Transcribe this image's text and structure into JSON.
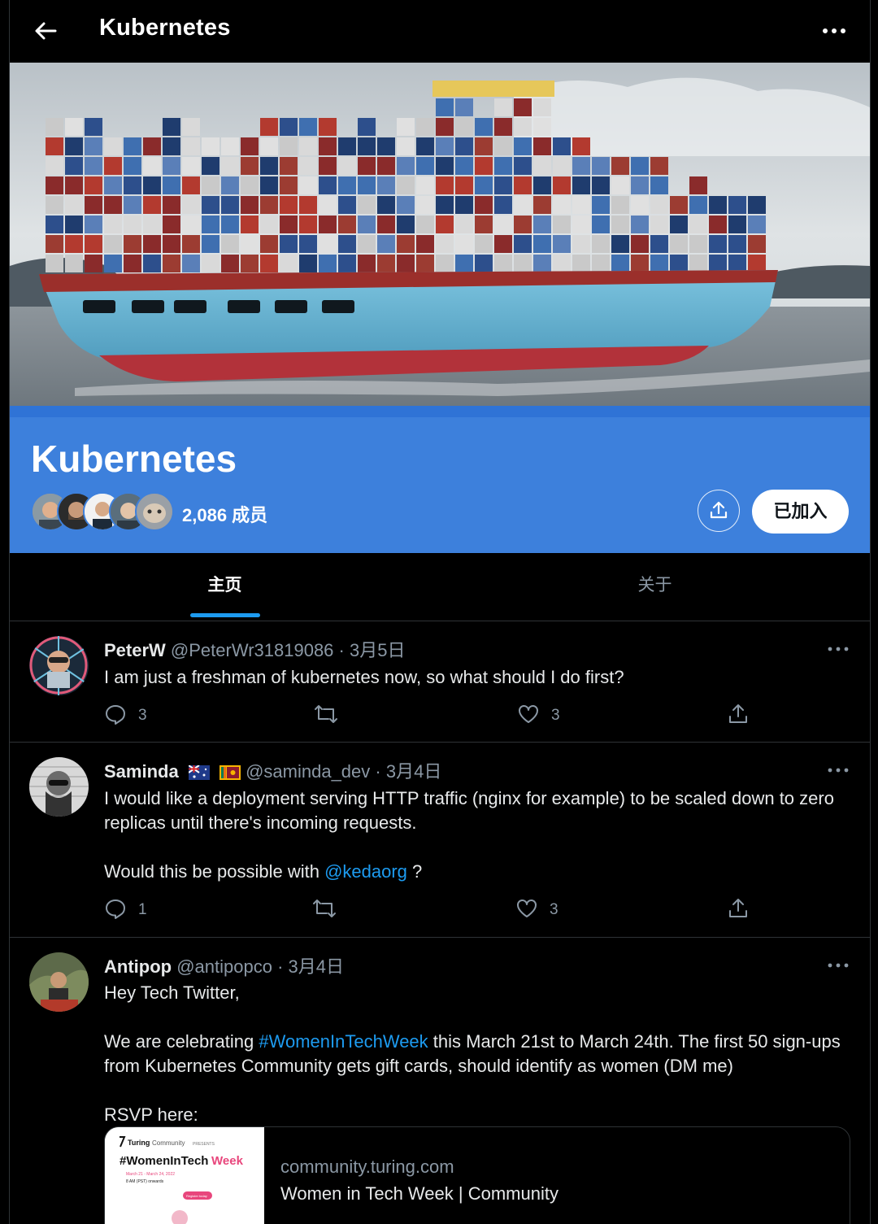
{
  "header": {
    "title": "Kubernetes"
  },
  "community": {
    "name": "Kubernetes",
    "member_count": "2,086 成员",
    "joined_label": "已加入",
    "band_color": "#3d80dc"
  },
  "tabs": [
    {
      "label": "主页",
      "active": true
    },
    {
      "label": "关于",
      "active": false
    }
  ],
  "posts": [
    {
      "name": "PeterW",
      "handle": "@PeterWr31819086",
      "date": "3月5日",
      "text": "I am just a freshman of kubernetes now, so what should I do first?",
      "replies": "3",
      "likes": "3"
    },
    {
      "name": "Saminda",
      "handle": "@saminda_dev",
      "date": "3月4日",
      "text1": "I would like a deployment serving HTTP traffic (nginx for example) to be scaled down to zero replicas until there's  incoming requests.",
      "text2_prefix": "Would this be possible with ",
      "mention": "@kedaorg",
      "text2_suffix": " ?",
      "replies": "1",
      "likes": "3"
    },
    {
      "name": "Antipop",
      "handle": "@antipopco",
      "date": "3月4日",
      "line1": "Hey Tech Twitter,",
      "line2_prefix": "We are celebrating ",
      "hashtag": "#WomenInTechWeek",
      "line2_suffix": " this March 21st to March 24th. The first 50 sign-ups from Kubernetes Community gets gift cards, should identify as women (DM me)",
      "line3": "RSVP here:",
      "card": {
        "domain": "community.turing.com",
        "title": "Women in Tech Week | Community",
        "thumb_brand": "Turing",
        "thumb_brand_sub": "Community",
        "thumb_presents": "PRESENTS",
        "thumb_tag_a": "#WomenInTech",
        "thumb_tag_b": "Week",
        "thumb_dates": "March 21 - March 24, 2022",
        "thumb_time": "8 AM (PST) onwards",
        "thumb_cta": "Register today"
      }
    }
  ],
  "colors": {
    "accent": "#1d9bf0",
    "muted": "#8b98a5",
    "divider": "#2f3336"
  },
  "icons": [
    "back-arrow-icon",
    "more-icon",
    "share-icon",
    "reply-icon",
    "retweet-icon",
    "like-icon"
  ]
}
